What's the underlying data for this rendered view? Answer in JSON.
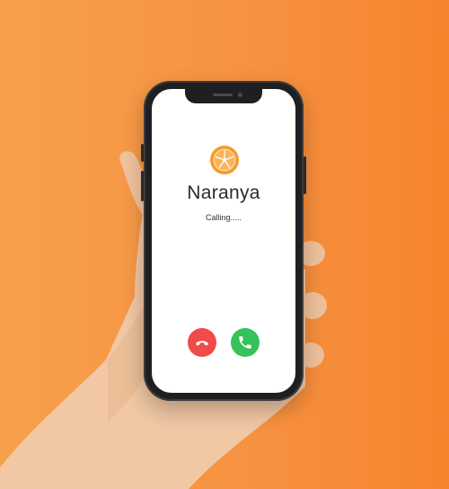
{
  "call": {
    "caller_name": "Naranya",
    "status": "Calling....."
  },
  "icons": {
    "avatar": "orange-slice-logo-icon",
    "decline": "phone-hangup-icon",
    "accept": "phone-icon"
  },
  "colors": {
    "background_start": "#f7a04c",
    "background_end": "#f6842d",
    "decline": "#f04a4a",
    "accept": "#34c25a",
    "logo_orange": "#f79a2c"
  }
}
